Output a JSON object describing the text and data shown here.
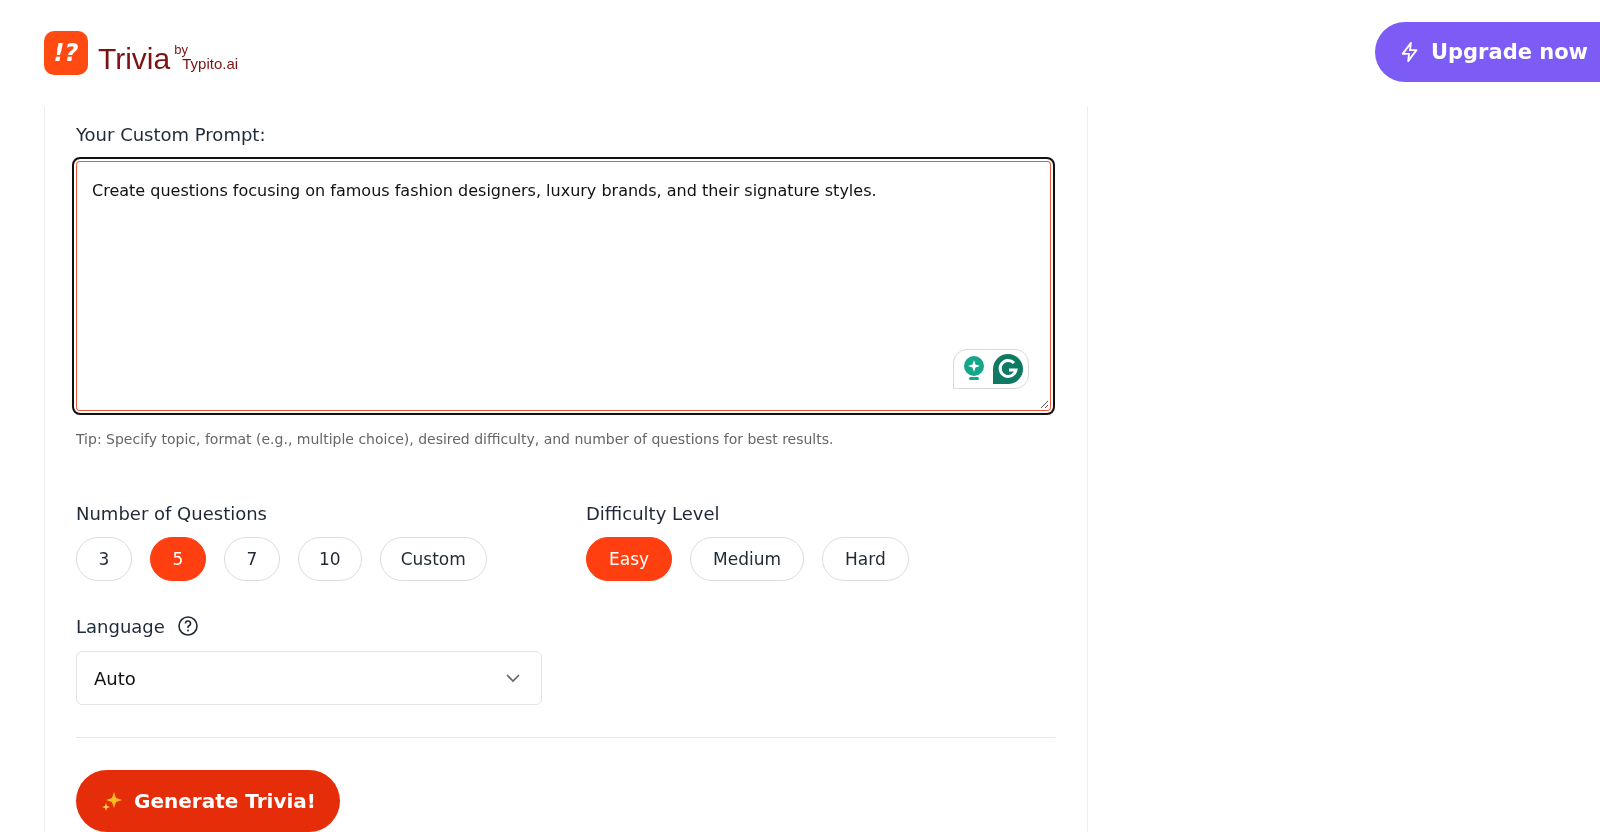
{
  "header": {
    "logo_mark": "!?",
    "brand": "Trivia",
    "by": "by",
    "maker": "Typito.ai",
    "upgrade_button": "Upgrade now"
  },
  "prompt": {
    "label": "Your Custom Prompt:",
    "value": "Create questions focusing on famous fashion designers, luxury brands, and their signature styles.",
    "tip": "Tip: Specify topic, format (e.g., multiple choice), desired difficulty, and number of questions for best results."
  },
  "questions": {
    "label": "Number of Questions",
    "options": [
      {
        "label": "3",
        "selected": false
      },
      {
        "label": "5",
        "selected": true
      },
      {
        "label": "7",
        "selected": false
      },
      {
        "label": "10",
        "selected": false
      },
      {
        "label": "Custom",
        "selected": false
      }
    ]
  },
  "difficulty": {
    "label": "Difficulty Level",
    "options": [
      {
        "label": "Easy",
        "selected": true
      },
      {
        "label": "Medium",
        "selected": false
      },
      {
        "label": "Hard",
        "selected": false
      }
    ]
  },
  "language": {
    "label": "Language",
    "value": "Auto"
  },
  "generate_button": "Generate Trivia!"
}
